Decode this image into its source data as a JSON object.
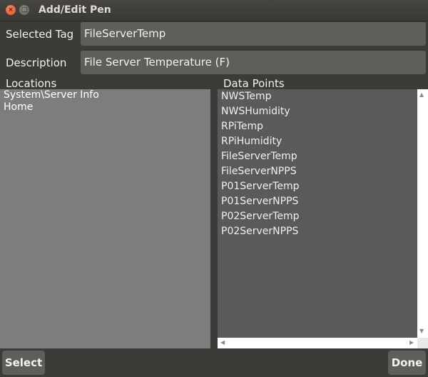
{
  "window": {
    "title": "Add/Edit Pen",
    "close_glyph": "×",
    "maximize_glyph": "□"
  },
  "form": {
    "selected_tag_label": "Selected Tag",
    "selected_tag_value": "FileServerTemp",
    "description_label": "Description",
    "description_value": "File Server Temperature (F)"
  },
  "locations": {
    "header": "Locations",
    "items": [
      "System\\Server Info",
      "Home"
    ]
  },
  "data_points": {
    "header": "Data Points",
    "items": [
      "NWSTemp",
      "NWSHumidity",
      "RPiTemp",
      "RPiHumidity",
      "FileServerTemp",
      "FileServerNPPS",
      "P01ServerTemp",
      "P01ServerNPPS",
      "P02ServerTemp",
      "P02ServerNPPS"
    ]
  },
  "scroll_arrows": {
    "up": "▲",
    "down": "▼",
    "left": "◀",
    "right": "▶"
  },
  "buttons": {
    "select_label": "Select",
    "done_label": "Done"
  }
}
